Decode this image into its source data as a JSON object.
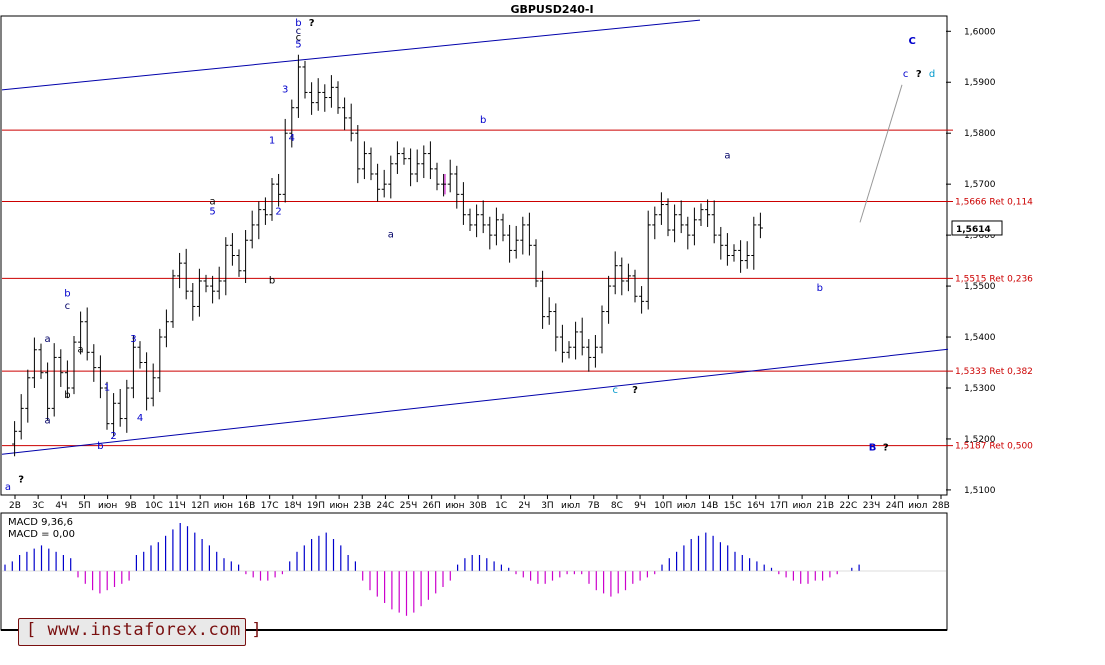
{
  "chart_data": {
    "type": "ohlc",
    "title": "GBPUSD240-I",
    "price_axis": {
      "ticks": [
        "1,6000",
        "1,5900",
        "1,5800",
        "1,5700",
        "1,5600",
        "1,5500",
        "1,5400",
        "1,5300",
        "1,5200",
        "1,5100"
      ],
      "range": [
        1.509,
        1.603
      ],
      "current_price": "1,5614"
    },
    "date_ticks": [
      "2В",
      "3С",
      "4Ч",
      "5П",
      "июн",
      "9В",
      "10С",
      "11Ч",
      "12П",
      "июн",
      "16В",
      "17С",
      "18Ч",
      "19П",
      "июн",
      "23В",
      "24С",
      "25Ч",
      "26П",
      "июн",
      "30В",
      "1С",
      "2Ч",
      "3П",
      "июл",
      "7В",
      "8С",
      "9Ч",
      "10П",
      "июл",
      "14В",
      "15С",
      "16Ч",
      "17П",
      "июл",
      "21В",
      "22С",
      "23Ч",
      "24П",
      "июл",
      "28В"
    ],
    "fibonacci_levels": [
      {
        "label": "1,5666 Ret 0,114",
        "price": 1.5666
      },
      {
        "label": "1,5515 Ret 0,236",
        "price": 1.5515
      },
      {
        "label": "1,5333 Ret 0,382",
        "price": 1.5333
      },
      {
        "label": "1,5187 Ret 0,500",
        "price": 1.5187
      }
    ],
    "top_level_line": 1.5806,
    "price_path": [
      [
        0,
        1.519
      ],
      [
        1,
        1.5215
      ],
      [
        2,
        1.526
      ],
      [
        3,
        1.532
      ],
      [
        4,
        1.5375
      ],
      [
        5,
        1.533
      ],
      [
        6,
        1.526
      ],
      [
        7,
        1.536
      ],
      [
        8,
        1.533
      ],
      [
        9,
        1.53
      ],
      [
        10,
        1.539
      ],
      [
        11,
        1.543
      ],
      [
        12,
        1.537
      ],
      [
        13,
        1.534
      ],
      [
        14,
        1.53
      ],
      [
        15,
        1.523
      ],
      [
        16,
        1.527
      ],
      [
        17,
        1.524
      ],
      [
        18,
        1.53
      ],
      [
        19,
        1.538
      ],
      [
        20,
        1.535
      ],
      [
        21,
        1.528
      ],
      [
        22,
        1.532
      ],
      [
        23,
        1.54
      ],
      [
        24,
        1.543
      ],
      [
        25,
        1.552
      ],
      [
        26,
        1.5545
      ],
      [
        27,
        1.549
      ],
      [
        28,
        1.546
      ],
      [
        29,
        1.551
      ],
      [
        30,
        1.55
      ],
      [
        31,
        1.549
      ],
      [
        32,
        1.551
      ],
      [
        33,
        1.558
      ],
      [
        34,
        1.556
      ],
      [
        35,
        1.553
      ],
      [
        36,
        1.559
      ],
      [
        37,
        1.562
      ],
      [
        38,
        1.565
      ],
      [
        39,
        1.564
      ],
      [
        40,
        1.57
      ],
      [
        41,
        1.568
      ],
      [
        42,
        1.58
      ],
      [
        43,
        1.585
      ],
      [
        44,
        1.593
      ],
      [
        45,
        1.588
      ],
      [
        46,
        1.586
      ],
      [
        47,
        1.588
      ],
      [
        48,
        1.587
      ],
      [
        49,
        1.589
      ],
      [
        50,
        1.585
      ],
      [
        51,
        1.583
      ],
      [
        52,
        1.58
      ],
      [
        53,
        1.573
      ],
      [
        54,
        1.576
      ],
      [
        55,
        1.572
      ],
      [
        56,
        1.569
      ],
      [
        57,
        1.57
      ],
      [
        58,
        1.574
      ],
      [
        59,
        1.576
      ],
      [
        60,
        1.575
      ],
      [
        61,
        1.572
      ],
      [
        62,
        1.574
      ],
      [
        63,
        1.576
      ],
      [
        64,
        1.573
      ],
      [
        65,
        1.57
      ],
      [
        66,
        1.57
      ],
      [
        67,
        1.572
      ],
      [
        68,
        1.568
      ],
      [
        69,
        1.564
      ],
      [
        70,
        1.562
      ],
      [
        71,
        1.564
      ],
      [
        72,
        1.562
      ],
      [
        73,
        1.56
      ],
      [
        74,
        1.563
      ],
      [
        75,
        1.56
      ],
      [
        76,
        1.557
      ],
      [
        77,
        1.559
      ],
      [
        78,
        1.562
      ],
      [
        79,
        1.558
      ],
      [
        80,
        1.551
      ],
      [
        81,
        1.544
      ],
      [
        82,
        1.545
      ],
      [
        83,
        1.54
      ],
      [
        84,
        1.537
      ],
      [
        85,
        1.538
      ],
      [
        86,
        1.541
      ],
      [
        87,
        1.538
      ],
      [
        88,
        1.536
      ],
      [
        89,
        1.538
      ],
      [
        90,
        1.545
      ],
      [
        91,
        1.55
      ],
      [
        92,
        1.554
      ],
      [
        93,
        1.551
      ],
      [
        94,
        1.552
      ],
      [
        95,
        1.548
      ],
      [
        96,
        1.547
      ],
      [
        97,
        1.562
      ],
      [
        98,
        1.564
      ],
      [
        99,
        1.566
      ],
      [
        100,
        1.561
      ],
      [
        101,
        1.564
      ],
      [
        102,
        1.562
      ],
      [
        103,
        1.56
      ],
      [
        104,
        1.563
      ],
      [
        105,
        1.565
      ],
      [
        106,
        1.564
      ],
      [
        107,
        1.56
      ],
      [
        108,
        1.558
      ],
      [
        109,
        1.556
      ],
      [
        110,
        1.557
      ],
      [
        111,
        1.555
      ],
      [
        112,
        1.556
      ],
      [
        113,
        1.562
      ],
      [
        114,
        1.5614
      ]
    ],
    "wave_labels": [
      {
        "text": "b",
        "color": "#0000cc",
        "bar": 44,
        "price": 1.601
      },
      {
        "text": "?",
        "color": "#000000",
        "bar": 46,
        "price": 1.601
      },
      {
        "text": "c",
        "color": "#000066",
        "bar": 44,
        "price": 1.5995
      },
      {
        "text": "c",
        "color": "#000000",
        "bar": 44,
        "price": 1.5982
      },
      {
        "text": "5",
        "color": "#0000cc",
        "bar": 44,
        "price": 1.5968
      },
      {
        "text": "C",
        "color": "#0000cc",
        "bar": 137,
        "price": 1.5975
      },
      {
        "text": "c",
        "color": "#0000cc",
        "bar": 136,
        "price": 1.591
      },
      {
        "text": "?",
        "color": "#000000",
        "bar": 138,
        "price": 1.591
      },
      {
        "text": "d",
        "color": "#0099cc",
        "bar": 140,
        "price": 1.591
      },
      {
        "text": "b",
        "color": "#0000cc",
        "bar": 72,
        "price": 1.582
      },
      {
        "text": "B",
        "color": "#0000cc",
        "bar": 131,
        "price": 1.5177
      },
      {
        "text": "?",
        "color": "#000000",
        "bar": 133,
        "price": 1.5177
      },
      {
        "text": "c",
        "color": "#0099cc",
        "bar": 92,
        "price": 1.529
      },
      {
        "text": "?",
        "color": "#000000",
        "bar": 95,
        "price": 1.529
      },
      {
        "text": "b",
        "color": "#000000",
        "bar": 40,
        "price": 1.5505
      },
      {
        "text": "a",
        "color": "#000066",
        "bar": 58,
        "price": 1.5595
      },
      {
        "text": "a",
        "color": "#000066",
        "bar": 109,
        "price": 1.575
      },
      {
        "text": "b",
        "color": "#0000cc",
        "bar": 123,
        "price": 1.549
      },
      {
        "text": "a",
        "color": "#000066",
        "bar": 6,
        "price": 1.539
      },
      {
        "text": "b",
        "color": "#0000cc",
        "bar": 14,
        "price": 1.518
      },
      {
        "text": "a",
        "color": "#0000cc",
        "bar": 0,
        "price": 1.51
      },
      {
        "text": "?",
        "color": "#000000",
        "bar": 2,
        "price": 1.5115
      },
      {
        "text": "3",
        "color": "#0000cc",
        "bar": 42,
        "price": 1.588
      },
      {
        "text": "4",
        "color": "#0000cc",
        "bar": 43,
        "price": 1.5785
      },
      {
        "text": "1",
        "color": "#0000cc",
        "bar": 40,
        "price": 1.578
      },
      {
        "text": "2",
        "color": "#0000cc",
        "bar": 41,
        "price": 1.564
      },
      {
        "text": "5",
        "color": "#0000cc",
        "bar": 31,
        "price": 1.564
      },
      {
        "text": "a",
        "color": "#000000",
        "bar": 31,
        "price": 1.566
      },
      {
        "text": "1",
        "color": "#0000cc",
        "bar": 15,
        "price": 1.5295
      },
      {
        "text": "2",
        "color": "#0000cc",
        "bar": 16,
        "price": 1.52
      },
      {
        "text": "3",
        "color": "#0000cc",
        "bar": 19,
        "price": 1.539
      },
      {
        "text": "4",
        "color": "#0000cc",
        "bar": 20,
        "price": 1.5235
      },
      {
        "text": "b",
        "color": "#0000cc",
        "bar": 9,
        "price": 1.548
      },
      {
        "text": "c",
        "color": "#000066",
        "bar": 9,
        "price": 1.5455
      },
      {
        "text": "a",
        "color": "#000000",
        "bar": 11,
        "price": 1.537
      },
      {
        "text": "b",
        "color": "#000000",
        "bar": 9,
        "price": 1.528
      },
      {
        "text": "a",
        "color": "#000066",
        "bar": 6,
        "price": 1.523
      }
    ],
    "macd": {
      "label": "MACD 9,36,6",
      "value_label": "MACD = 0,00",
      "values": [
        2,
        3,
        5,
        6,
        7,
        8,
        7,
        6,
        5,
        4,
        -2,
        -4,
        -6,
        -7,
        -6,
        -5,
        -4,
        -3,
        5,
        6,
        8,
        9,
        11,
        13,
        15,
        14,
        12,
        10,
        8,
        6,
        4,
        3,
        2,
        -1,
        -2,
        -3,
        -3,
        -2,
        -1,
        3,
        6,
        8,
        10,
        11,
        12,
        10,
        8,
        5,
        3,
        -3,
        -6,
        -8,
        -10,
        -12,
        -13,
        -14,
        -13,
        -11,
        -9,
        -7,
        -5,
        -3,
        2,
        4,
        5,
        5,
        4,
        3,
        2,
        1,
        -1,
        -2,
        -3,
        -4,
        -4,
        -3,
        -2,
        -1,
        -1,
        -1,
        -4,
        -6,
        -7,
        -8,
        -7,
        -6,
        -4,
        -3,
        -2,
        -1,
        2,
        4,
        6,
        8,
        10,
        11,
        12,
        11,
        9,
        8,
        6,
        5,
        4,
        3,
        2,
        1,
        -1,
        -2,
        -3,
        -4,
        -4,
        -3,
        -3,
        -2,
        -1,
        0,
        1,
        2
      ]
    }
  },
  "watermark": "[  www.instaforex.com  ]"
}
